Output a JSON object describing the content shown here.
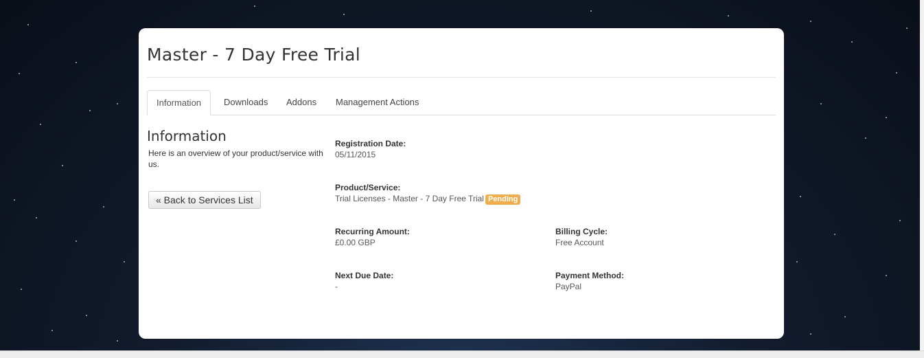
{
  "page": {
    "title": "Master - 7 Day Free Trial"
  },
  "tabs": [
    {
      "label": "Information",
      "active": true
    },
    {
      "label": "Downloads",
      "active": false
    },
    {
      "label": "Addons",
      "active": false
    },
    {
      "label": "Management Actions",
      "active": false
    }
  ],
  "sidebar": {
    "heading": "Information",
    "description": "Here is an overview of your product/service with us.",
    "back_button": "« Back to Services List"
  },
  "details": {
    "registration_date": {
      "label": "Registration Date:",
      "value": "05/11/2015"
    },
    "product_service": {
      "label": "Product/Service:",
      "value": "Trial Licenses - Master - 7 Day Free Trial",
      "status": "Pending"
    },
    "recurring_amount": {
      "label": "Recurring Amount:",
      "value": "£0.00 GBP"
    },
    "billing_cycle": {
      "label": "Billing Cycle:",
      "value": "Free Account"
    },
    "next_due_date": {
      "label": "Next Due Date:",
      "value": "-"
    },
    "payment_method": {
      "label": "Payment Method:",
      "value": "PayPal"
    }
  },
  "colors": {
    "status_pending": "#f0ad4e",
    "panel_background": "#ffffff",
    "page_background": "#0e1522"
  }
}
